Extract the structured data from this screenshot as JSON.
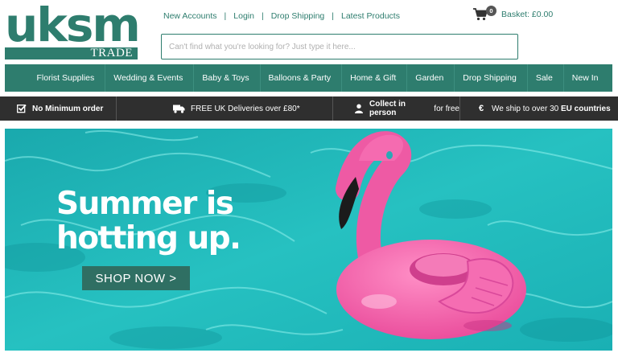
{
  "logo": {
    "main": "uksm",
    "sub": "TRADE"
  },
  "toplinks": [
    "New Accounts",
    "Login",
    "Drop Shipping",
    "Latest Products"
  ],
  "basket": {
    "count": "0",
    "label": "Basket: £0.00"
  },
  "search": {
    "placeholder": "Can't find what you're looking for? Just type it here..."
  },
  "nav": [
    "Florist Supplies",
    "Wedding & Events",
    "Baby & Toys",
    "Balloons & Party",
    "Home & Gift",
    "Garden",
    "Drop Shipping",
    "Sale",
    "New In"
  ],
  "usp": {
    "minimum": "No Minimum order",
    "delivery": "FREE UK Deliveries over £80*",
    "collect_bold": "Collect in person",
    "collect_rest": " for free",
    "ship_pre": "We ship to over 30 ",
    "ship_bold": "EU countries"
  },
  "hero": {
    "line1": "Summer is",
    "line2": "hotting up.",
    "cta": "SHOP NOW >"
  },
  "colors": {
    "brand": "#2e7d6e",
    "usp_bar": "#2f2f2f",
    "pool": "#23b8b8",
    "flamingo": "#f25fa9"
  }
}
